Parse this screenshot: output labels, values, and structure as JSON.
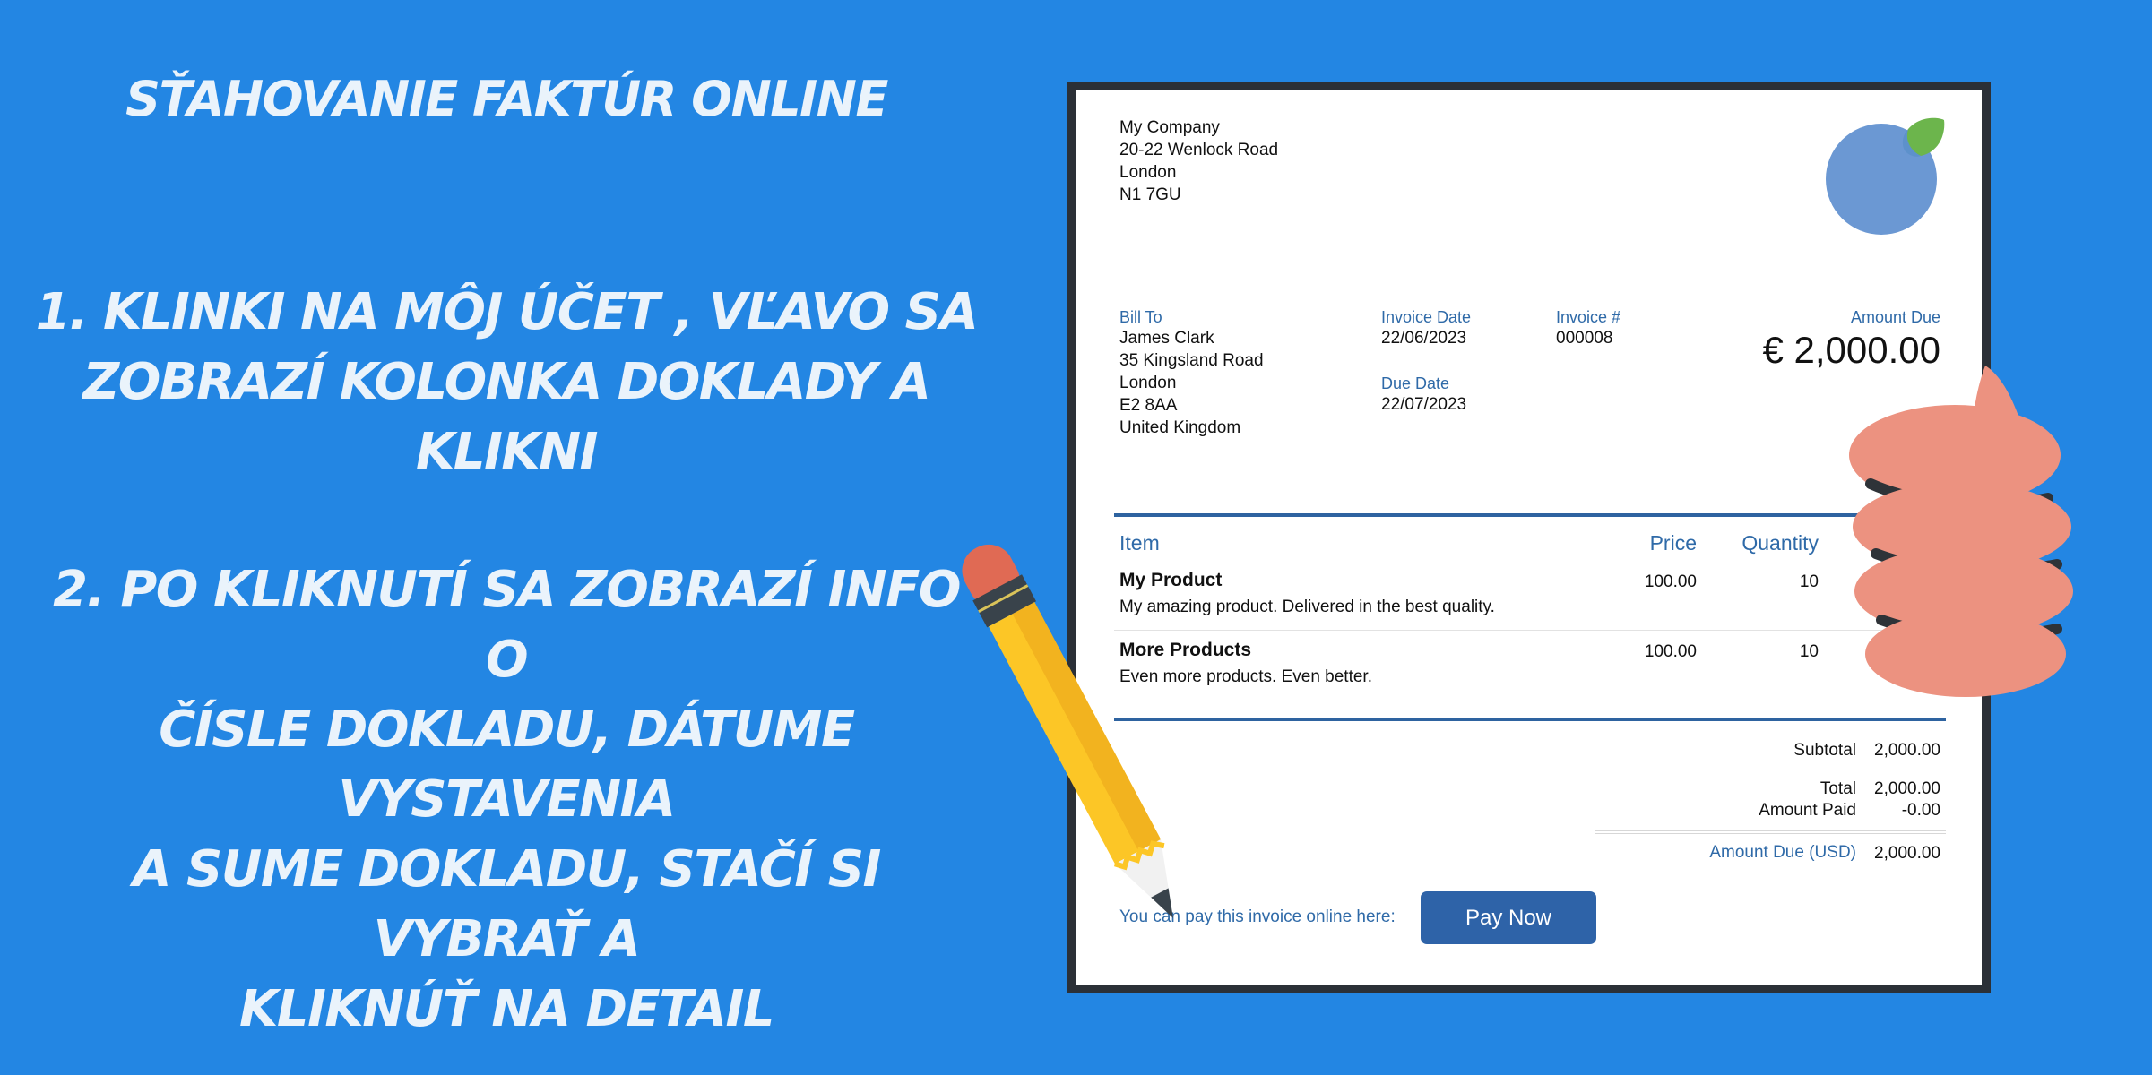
{
  "poster": {
    "title": "SŤAHOVANIE FAKTÚR ONLINE",
    "step1": "1. KLINKI NA MÔJ ÚČET , VĽAVO SA\nZOBRAZÍ KOLONKA DOKLADY A KLIKNI",
    "step2": "2.  PO KLIKNUTÍ SA ZOBRAZÍ INFO O\nČÍSLE DOKLADU, DÁTUME VYSTAVENIA\nA SUME DOKLADU, STAČÍ SI VYBRAŤ A\nKLIKNÚŤ NA DETAIL"
  },
  "invoice": {
    "company_address": "My Company\n20-22 Wenlock Road\nLondon\nN1 7GU",
    "bill_to_label": "Bill To",
    "bill_to_address": "James Clark\n35 Kingsland Road\nLondon\nE2 8AA\nUnited Kingdom",
    "invoice_date_label": "Invoice Date",
    "invoice_date": "22/06/2023",
    "due_date_label": "Due Date",
    "due_date": "22/07/2023",
    "invoice_no_label": "Invoice #",
    "invoice_no": "000008",
    "amount_due_label": "Amount Due",
    "amount_due": "€ 2,000.00",
    "columns": {
      "item": "Item",
      "price": "Price",
      "quantity": "Quantity"
    },
    "items": [
      {
        "name": "My Product",
        "description": "My amazing product. Delivered in the best quality.",
        "price": "100.00",
        "quantity": "10"
      },
      {
        "name": "More Products",
        "description": "Even more products. Even better.",
        "price": "100.00",
        "quantity": "10"
      }
    ],
    "totals": {
      "subtotal_label": "Subtotal",
      "subtotal": "2,000.00",
      "total_label": "Total",
      "total": "&#8202;2,000.00",
      "amount_paid_label": "Amount Paid",
      "amount_paid": "-0.00",
      "amount_due_usd_label": "Amount Due (USD)",
      "amount_due_usd": "2,000.00"
    },
    "pay_text": "You can pay this invoice online here:",
    "pay_button": "Pay Now"
  },
  "colors": {
    "background": "#2386e3",
    "headline_text": "#eaf3fb",
    "invoice_accent": "#2e63a0",
    "frame": "#2b3037",
    "pencil_body": "#fcc626",
    "pencil_eraser": "#e06a54",
    "hand": "#ec9280",
    "logo_circle": "#6b98d3",
    "logo_leaf": "#6cb54c"
  },
  "icons": [
    "logo-icon",
    "pencil-icon",
    "thumbs-up-hand-icon"
  ]
}
